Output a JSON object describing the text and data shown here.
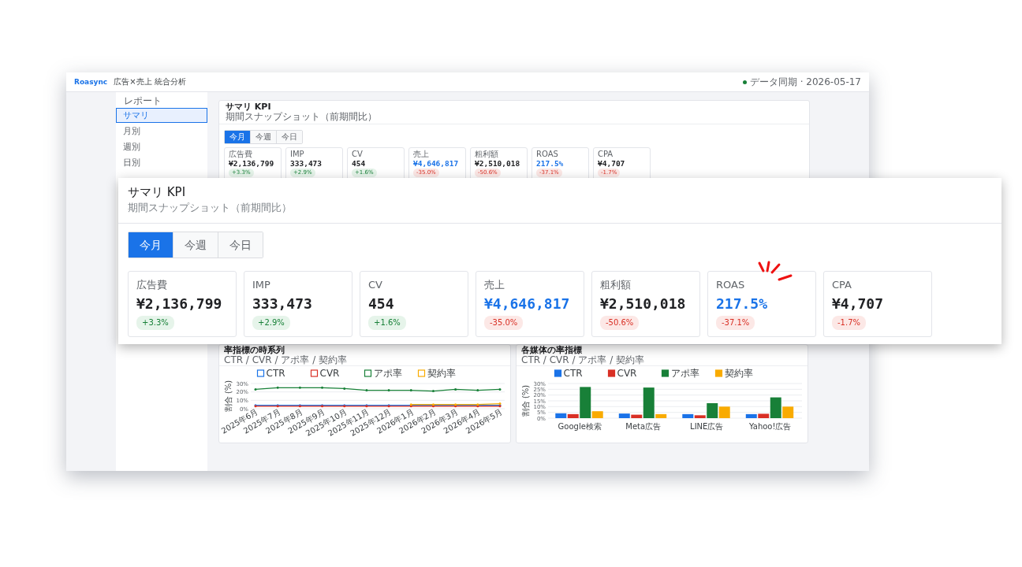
{
  "header": {
    "brand": "Roasync",
    "title": "広告×売上 統合分析",
    "sync_status": "データ同期 · 2026-05-17"
  },
  "sidebar": {
    "heading": "レポート",
    "items": [
      {
        "label": "サマリ",
        "selected": true
      },
      {
        "label": "月別",
        "selected": false
      },
      {
        "label": "週別",
        "selected": false
      },
      {
        "label": "日別",
        "selected": false
      }
    ]
  },
  "kpi_panel": {
    "title": "サマリ KPI",
    "subtitle": "期間スナップショット（前期間比）",
    "tabs": [
      {
        "label": "今月",
        "selected": true
      },
      {
        "label": "今週",
        "selected": false
      },
      {
        "label": "今日",
        "selected": false
      }
    ],
    "cards": [
      {
        "label": "広告費",
        "value": "¥2,136,799",
        "change": "+3.3%",
        "positive": true,
        "highlight": false
      },
      {
        "label": "IMP",
        "value": "333,473",
        "change": "+2.9%",
        "positive": true,
        "highlight": false
      },
      {
        "label": "CV",
        "value": "454",
        "change": "+1.6%",
        "positive": true,
        "highlight": false
      },
      {
        "label": "売上",
        "value": "¥4,646,817",
        "change": "-35.0%",
        "positive": false,
        "highlight": true
      },
      {
        "label": "粗利額",
        "value": "¥2,510,018",
        "change": "-50.6%",
        "positive": false,
        "highlight": false
      },
      {
        "label": "ROAS",
        "value": "217.5%",
        "change": "-37.1%",
        "positive": false,
        "highlight": true
      },
      {
        "label": "CPA",
        "value": "¥4,707",
        "change": "-1.7%",
        "positive": false,
        "highlight": false
      }
    ]
  },
  "charts": [
    {
      "title": "率指標の時系列",
      "subtitle": "CTR / CVR / アポ率 / 契約率",
      "chart_data": {
        "type": "line",
        "ylabel": "割合 (%)",
        "categories": [
          "2025年6月",
          "2025年7月",
          "2025年8月",
          "2025年9月",
          "2025年10月",
          "2025年11月",
          "2025年12月",
          "2026年1月",
          "2026年2月",
          "2026年3月",
          "2026年4月",
          "2026年5月"
        ],
        "ylim": [
          0,
          30
        ],
        "yticks": [
          {
            "value": 0,
            "label": "0%"
          },
          {
            "value": 10,
            "label": "10%"
          },
          {
            "value": 20,
            "label": "20%"
          },
          {
            "value": 30,
            "label": "30%"
          }
        ],
        "series": [
          {
            "name": "CTR",
            "color": "#1a73e8",
            "values": [
              4,
              4,
              4,
              4,
              4,
              4,
              4,
              4,
              4,
              4,
              4,
              4
            ]
          },
          {
            "name": "CVR",
            "color": "#d93025",
            "values": [
              3,
              3,
              3,
              3,
              3,
              3,
              3,
              3,
              3,
              3,
              3,
              3
            ]
          },
          {
            "name": "アポ率",
            "color": "#188038",
            "values": [
              23,
              25,
              25,
              25,
              24,
              22,
              22,
              22,
              21,
              23,
              22,
              23
            ]
          },
          {
            "name": "契約率",
            "color": "#f9ab00",
            "values": [
              null,
              null,
              null,
              null,
              null,
              null,
              null,
              5,
              5,
              5,
              5,
              6
            ]
          }
        ],
        "legend": "top",
        "grid": true
      }
    },
    {
      "title": "各媒体の率指標",
      "subtitle": "CTR / CVR / アポ率 / 契約率",
      "chart_data": {
        "type": "bar",
        "ylabel": "割合 (%)",
        "categories": [
          "Google検索",
          "Meta広告",
          "LINE広告",
          "Yahoo!広告"
        ],
        "ylim": [
          0,
          30
        ],
        "yticks": [
          {
            "value": 0,
            "label": "0%"
          },
          {
            "value": 5,
            "label": "5%"
          },
          {
            "value": 10,
            "label": "10%"
          },
          {
            "value": 15,
            "label": "15%"
          },
          {
            "value": 20,
            "label": "20%"
          },
          {
            "value": 25,
            "label": "25%"
          },
          {
            "value": 30,
            "label": "30%"
          }
        ],
        "series": [
          {
            "name": "CTR",
            "color": "#1a73e8",
            "values": [
              4.2,
              4,
              3.5,
              3.5
            ]
          },
          {
            "name": "CVR",
            "color": "#d93025",
            "values": [
              3.5,
              3,
              2.5,
              3.8
            ]
          },
          {
            "name": "アポ率",
            "color": "#188038",
            "values": [
              27,
              26.5,
              13,
              18
            ]
          },
          {
            "name": "契約率",
            "color": "#f9ab00",
            "values": [
              6,
              3.5,
              10,
              10
            ]
          }
        ],
        "legend": "top",
        "grid": true
      }
    }
  ],
  "callout": {
    "title": "サマリ KPI",
    "subtitle": "期間スナップショット（前期間比）",
    "tabs": [
      {
        "label": "今月",
        "selected": true
      },
      {
        "label": "今週",
        "selected": false
      },
      {
        "label": "今日",
        "selected": false
      }
    ],
    "cards": [
      {
        "label": "広告費",
        "value": "¥2,136,799",
        "change": "+3.3%",
        "positive": true,
        "highlight": false,
        "emphasis": false
      },
      {
        "label": "IMP",
        "value": "333,473",
        "change": "+2.9%",
        "positive": true,
        "highlight": false,
        "emphasis": false
      },
      {
        "label": "CV",
        "value": "454",
        "change": "+1.6%",
        "positive": true,
        "highlight": false,
        "emphasis": false
      },
      {
        "label": "売上",
        "value": "¥4,646,817",
        "change": "-35.0%",
        "positive": false,
        "highlight": true,
        "emphasis": false
      },
      {
        "label": "粗利額",
        "value": "¥2,510,018",
        "change": "-50.6%",
        "positive": false,
        "highlight": false,
        "emphasis": false
      },
      {
        "label": "ROAS",
        "value": "217.5%",
        "change": "-37.1%",
        "positive": false,
        "highlight": true,
        "emphasis": true
      },
      {
        "label": "CPA",
        "value": "¥4,707",
        "change": "-1.7%",
        "positive": false,
        "highlight": false,
        "emphasis": false
      }
    ]
  }
}
